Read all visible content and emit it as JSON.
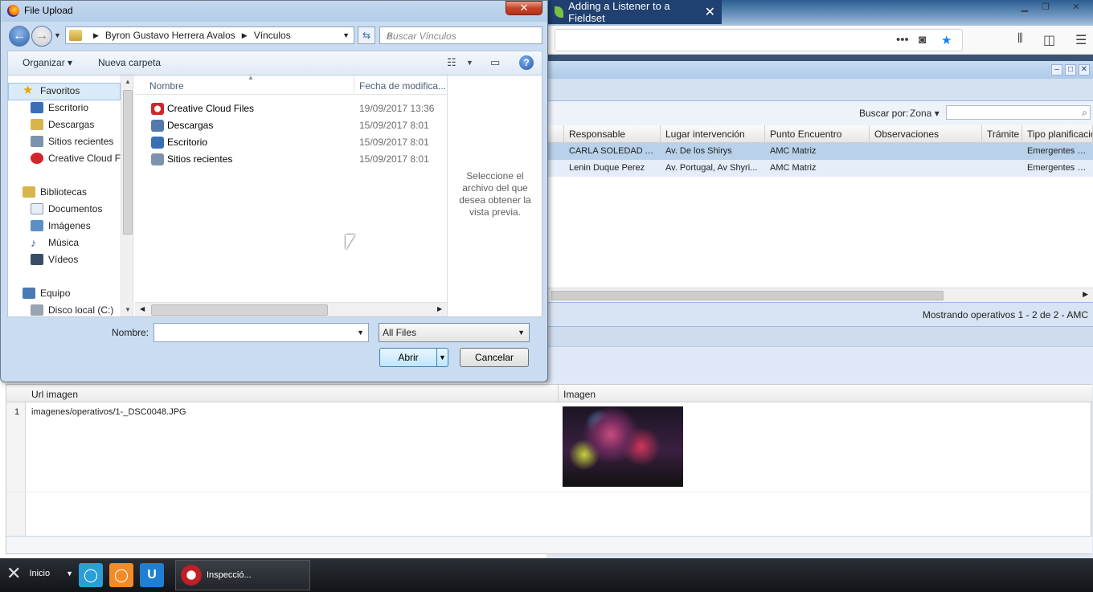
{
  "browser": {
    "active_tab_title": "Adding a Listener to a Fieldset",
    "bg_tabs": [
      "",
      ""
    ]
  },
  "ext": {
    "search_label": "Buscar por:",
    "search_combo": "Zona",
    "columns": [
      "Responsable",
      "Lugar intervención",
      "Punto Encuentro",
      "Observaciones",
      "Trámite",
      "Tipo planificació"
    ],
    "rows": [
      [
        "CARLA SOLEDAD A...",
        "Av. De los Shirys",
        "AMC Matriz",
        "",
        "",
        "Emergentes / No"
      ],
      [
        "Lenin Duque Perez",
        "Av. Portugal, Av Shyri...",
        "AMC Matriz",
        "",
        "",
        "Emergentes / No"
      ]
    ],
    "pager_text": "Mostrando operativos 1 - 2 de 2 - AMC"
  },
  "images_grid": {
    "columns": [
      "Url imagen",
      "Imagen"
    ],
    "rows": [
      {
        "num": "1",
        "url": "imagenes/operativos/1-_DSC0048.JPG"
      }
    ]
  },
  "dialog": {
    "title": "File Upload",
    "breadcrumb": [
      "Byron Gustavo Herrera Avalos",
      "Vínculos"
    ],
    "search_placeholder": "Buscar Vínculos",
    "organize_label": "Organizar",
    "new_folder_label": "Nueva carpeta",
    "nav": {
      "favorites": "Favoritos",
      "favorite_items": [
        "Escritorio",
        "Descargas",
        "Sitios recientes",
        "Creative Cloud Fi"
      ],
      "libraries": "Bibliotecas",
      "library_items": [
        "Documentos",
        "Imágenes",
        "Música",
        "Vídeos"
      ],
      "computer": "Equipo",
      "computer_items": [
        "Disco local (C:)"
      ]
    },
    "columns": {
      "name": "Nombre",
      "date": "Fecha de modifica..."
    },
    "files": [
      {
        "name": "Creative Cloud Files",
        "date": "19/09/2017 13:36"
      },
      {
        "name": "Descargas",
        "date": "15/09/2017 8:01"
      },
      {
        "name": "Escritorio",
        "date": "15/09/2017 8:01"
      },
      {
        "name": "Sitios recientes",
        "date": "15/09/2017 8:01"
      }
    ],
    "preview_text": "Seleccione el archivo del que desea obtener la vista previa.",
    "filename_label": "Nombre:",
    "filename_value": "",
    "filter_value": "All Files",
    "open_label": "Abrir",
    "cancel_label": "Cancelar"
  },
  "taskbar": {
    "start_label": "Inicio",
    "task_label": "Inspecció..."
  },
  "colors": {
    "accent": "#2e64b0",
    "row_selected": "#b9d1ea",
    "taskbar": "#1a1d21"
  }
}
